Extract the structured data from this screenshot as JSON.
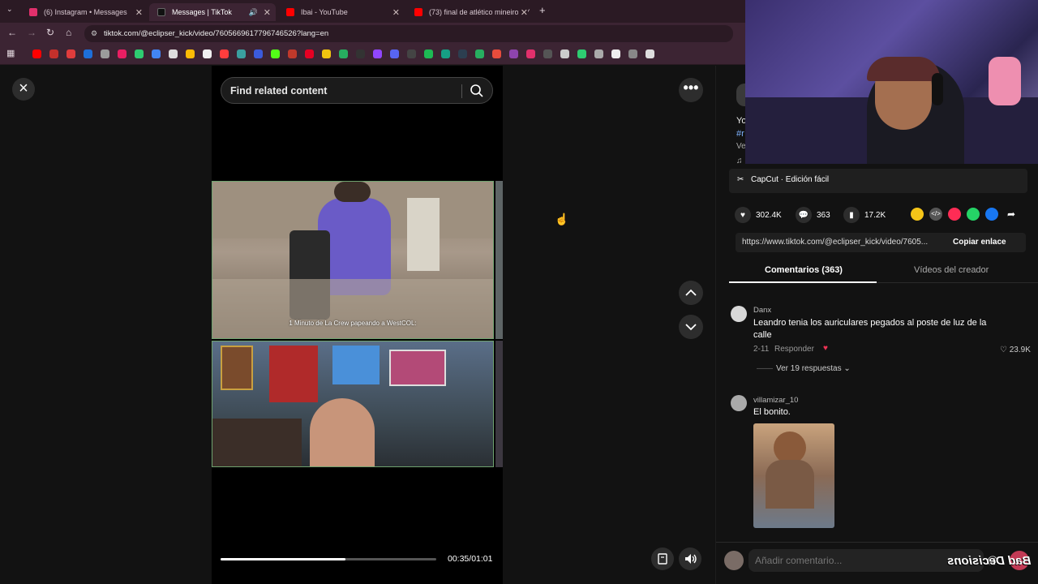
{
  "browser": {
    "tabs": [
      {
        "title": "(6) Instagram • Messages",
        "active": false,
        "color": "#e1306c"
      },
      {
        "title": "Messages | TikTok",
        "active": true,
        "color": "#111111"
      },
      {
        "title": "Ibai - YouTube",
        "active": false,
        "color": "#ff0000"
      },
      {
        "title": "(73) final de atlético mineiro - Y",
        "active": false,
        "color": "#ff0000"
      }
    ],
    "new_tab": "+",
    "url": "tiktok.com/@eclipser_kick/video/7605669617796746526?lang=en"
  },
  "player": {
    "close_icon": "×",
    "search_placeholder": "Find related content",
    "caption": "1 Minuto de La Crew papeando a WestCOL:",
    "progress": 0.58,
    "time": "00:35/01:01",
    "more_icon": "•••"
  },
  "panel": {
    "desc_fragment": "Yo",
    "tag_fragment": "#r",
    "ve_fragment": "Ve",
    "capcut": "CapCut · Edición fácil",
    "stats": {
      "likes": "302.4K",
      "comments": "363",
      "saves": "17.2K"
    },
    "share_colors": [
      "#f5c518",
      "#555555",
      "#fe2c55",
      "#25d366",
      "#1877f2"
    ],
    "link": "https://www.tiktok.com/@eclipser_kick/video/7605...",
    "copy_link": "Copiar enlace",
    "tabs": {
      "comments": "Comentarios (363)",
      "creator": "Vídeos del creador"
    },
    "comments": [
      {
        "user": "Danx",
        "text": "Leandro tenia los auriculares pegados al poste de luz de la calle",
        "date": "2-11",
        "reply": "Responder",
        "likes": "23.9K",
        "view_replies": "Ver 19 respuestas"
      },
      {
        "user": "villamizar_10",
        "text": "El bonito."
      }
    ],
    "comment_placeholder": "Añadir comentario..."
  },
  "overlay": {
    "watermark": "Bad Decisions"
  }
}
